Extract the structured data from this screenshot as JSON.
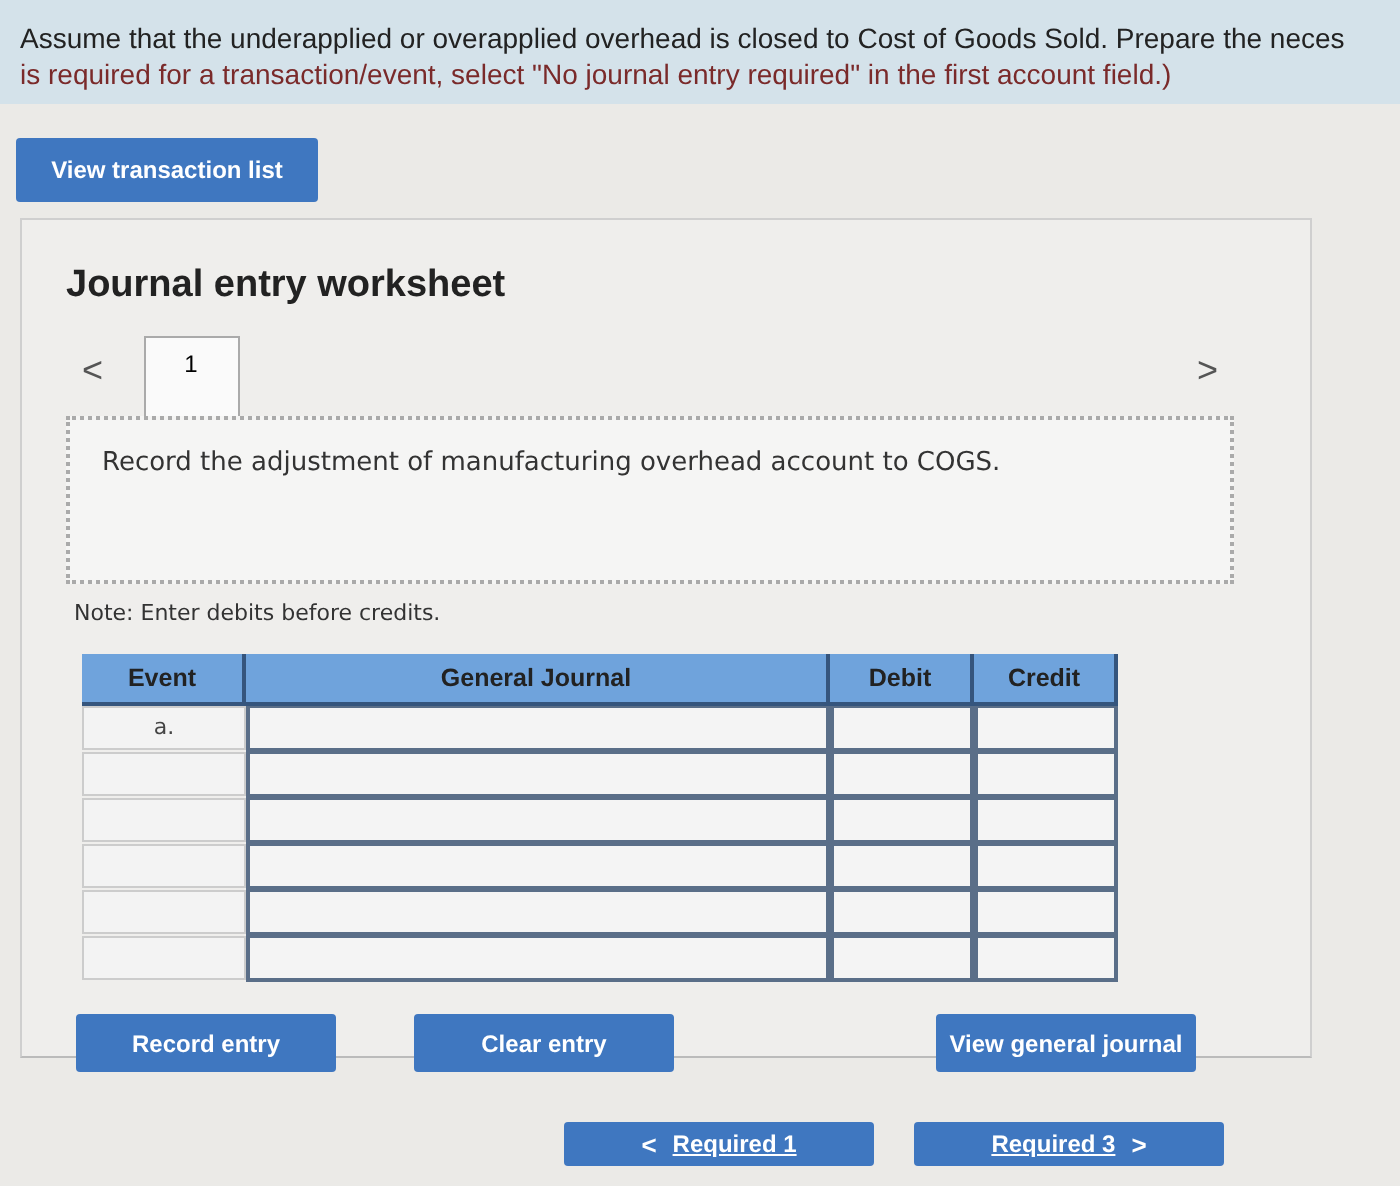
{
  "instructions": [
    "Assume that the underapplied or overapplied overhead is closed to Cost of Goods Sold. Prepare the neces",
    "is required for a transaction/event, select \"No journal entry required\" in the first account field.)"
  ],
  "view_transaction_button": "View transaction list",
  "worksheet": {
    "title": "Journal entry worksheet",
    "tabs": [
      {
        "label": "1",
        "selected": true
      }
    ],
    "prev": "<",
    "next": ">",
    "description": "Record the adjustment of manufacturing overhead account to COGS.",
    "note": "Note: Enter debits before credits.",
    "table": {
      "columns": [
        "Event",
        "General Journal",
        "Debit",
        "Credit"
      ],
      "rows": [
        {
          "event": "a."
        },
        {},
        {},
        {},
        {},
        {}
      ]
    },
    "buttons": [
      "Record entry",
      "Clear entry",
      "View general journal"
    ]
  },
  "nav": [
    {
      "label": "Required 1",
      "arrow": "<",
      "kind": "prev"
    },
    {
      "label": "Required 3",
      "arrow": ">",
      "kind": "next"
    }
  ]
}
